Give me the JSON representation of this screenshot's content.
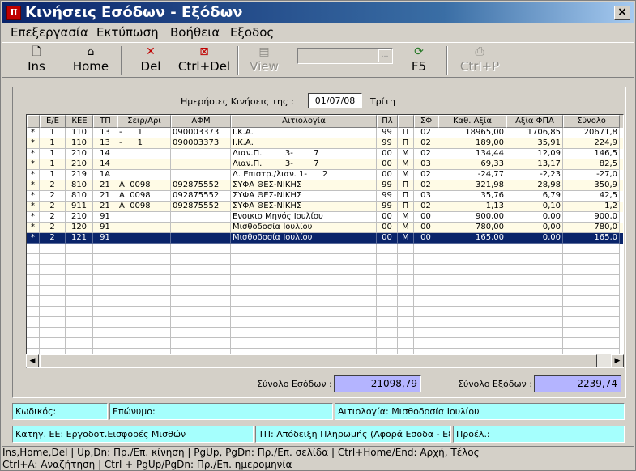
{
  "window": {
    "title": "Κινήσεις Εσόδων - Εξόδων",
    "close": "×"
  },
  "menu": [
    "Επεξεργασία",
    "Εκτύπωση",
    "Βοήθεια",
    "Εξοδος"
  ],
  "toolbar": {
    "ins": "Ins",
    "home": "Home",
    "del": "Del",
    "ctrl_del": "Ctrl+Del",
    "view": "View",
    "f5": "F5",
    "ctrl_p": "Ctrl+P"
  },
  "date_row": {
    "label": "Ημερήσιες Κινήσεις της :",
    "date": "01/07/08",
    "day": "Τρίτη"
  },
  "columns": [
    "Ε/Ε",
    "ΚΕΕ",
    "ΤΠ",
    "Σειρ/Αρι",
    "ΑΦΜ",
    "Αιτιολογία",
    "Πλ",
    "",
    "ΣΦ",
    "Καθ. Αξία",
    "Αξία ΦΠΑ",
    "Σύνολο"
  ],
  "rows": [
    [
      "*",
      "1",
      "110",
      "13",
      "-      1",
      "090003373",
      "Ι.Κ.Α.",
      "99",
      "Π",
      "02",
      "18965,00",
      "1706,85",
      "20671,8"
    ],
    [
      "*",
      "1",
      "110",
      "13",
      "-      1",
      "090003373",
      "Ι.Κ.Α.",
      "99",
      "Π",
      "02",
      "189,00",
      "35,91",
      "224,9"
    ],
    [
      "*",
      "1",
      "210",
      "14",
      "",
      "",
      "Λιαν.Π.         3-        7",
      "00",
      "Μ",
      "02",
      "134,44",
      "12,09",
      "146,5"
    ],
    [
      "*",
      "1",
      "210",
      "14",
      "",
      "",
      "Λιαν.Π.         3-        7",
      "00",
      "Μ",
      "03",
      "69,33",
      "13,17",
      "82,5"
    ],
    [
      "*",
      "1",
      "219",
      "1Α",
      "",
      "",
      "Δ. Επιστρ./λιαν. 1-      2",
      "00",
      "Μ",
      "02",
      "-24,77",
      "-2,23",
      "-27,0"
    ],
    [
      "*",
      "2",
      "810",
      "21",
      "Α  0098",
      "092875552",
      "ΣΥΦΑ ΘΕΣ-ΝΙΚΗΣ",
      "99",
      "Π",
      "02",
      "321,98",
      "28,98",
      "350,9"
    ],
    [
      "*",
      "2",
      "810",
      "21",
      "Α  0098",
      "092875552",
      "ΣΥΦΑ ΘΕΣ-ΝΙΚΗΣ",
      "99",
      "Π",
      "03",
      "35,76",
      "6,79",
      "42,5"
    ],
    [
      "*",
      "2",
      "911",
      "21",
      "Α  0098",
      "092875552",
      "ΣΥΦΑ ΘΕΣ-ΝΙΚΗΣ",
      "99",
      "Π",
      "02",
      "1,13",
      "0,10",
      "1,2"
    ],
    [
      "*",
      "2",
      "210",
      "91",
      "",
      "",
      "Ενοικιο Μηνός Ιουλίου",
      "00",
      "Μ",
      "00",
      "900,00",
      "0,00",
      "900,0"
    ],
    [
      "*",
      "2",
      "120",
      "91",
      "",
      "",
      "Μισθοδοσία Ιουλίου",
      "00",
      "Μ",
      "00",
      "780,00",
      "0,00",
      "780,0"
    ],
    [
      "*",
      "2",
      "121",
      "91",
      "",
      "",
      "Μισθοδοσία Ιουλίου",
      "00",
      "Μ",
      "00",
      "165,00",
      "0,00",
      "165,0"
    ]
  ],
  "selected_row": 10,
  "totals": {
    "income_label": "Σύνολο Εσόδων :",
    "income_value": "21098,79",
    "expense_label": "Σύνολο Εξόδων :",
    "expense_value": "2239,74"
  },
  "fields": {
    "code": "Κωδικός:",
    "surname": "Επώνυμο:",
    "reason": "Αιτιολογία: Μισθοδοσία Ιουλίου",
    "category": "Κατηγ. ΕΕ: Εργοδοτ.Εισφορές Μισθών",
    "doc_type": "ΤΠ: Απόδειξη Πληρωμής  (Αφορά Εσοδα - Εξοδα)",
    "origin": "Προέλ.:"
  },
  "status": {
    "line1": "Ins,Home,Del  |  Up,Dn: Πρ./Επ. κίνηση  |  PgUp, PgDn: Πρ./Επ. σελίδα  |  Ctrl+Home/End: Αρχή, Τέλος",
    "line2": "Ctrl+A: Αναζήτηση  |  Ctrl + PgUp/PgDn: Πρ./Επ. ημερομηνία"
  },
  "colors": {
    "title_start": "#0a246a",
    "selected_row": "#0a246a",
    "total_box": "#b4b4ff",
    "field_bg": "#a5fffd"
  }
}
